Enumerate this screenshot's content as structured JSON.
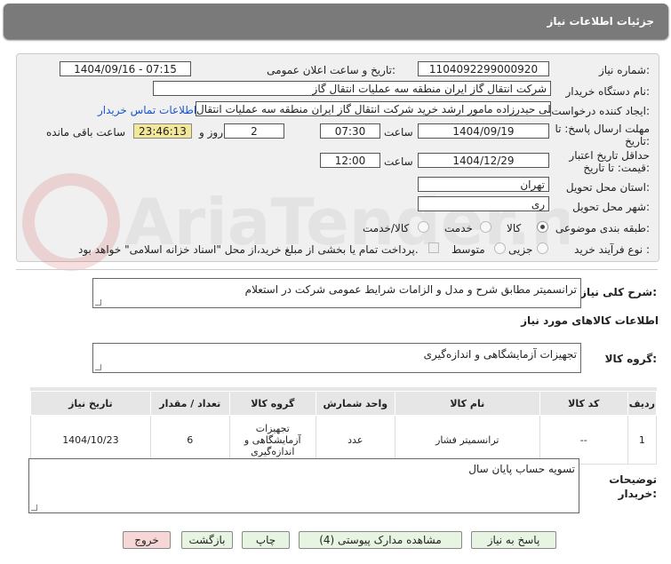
{
  "header": {
    "title": "جزئیات اطلاعات نیاز"
  },
  "form": {
    "need_number_label": "شماره نیاز:",
    "need_number": "1104092299000920",
    "announce_label": "تاریخ و ساعت اعلان عمومی:",
    "announce_value": "1404/09/16 - 07:15",
    "buyer_org_label": "نام دستگاه خریدار:",
    "buyer_org": "شرکت انتقال گاز ایران منطقه سه عملیات انتقال گاز",
    "creator_label": "ایجاد کننده درخواست:",
    "creator": "علی حیدرزاده مامور ارشد خرید شرکت انتقال گاز ایران منطقه سه عملیات انتقال",
    "contact_link": "اطلاعات تماس خریدار",
    "deadline_label_1": "مهلت ارسال پاسخ: تا",
    "deadline_label_2": "تاریخ:",
    "deadline_date": "1404/09/19",
    "time_label": "ساعت",
    "deadline_time": "07:30",
    "days_value": "2",
    "days_label": "روز و",
    "remaining_time": "23:46:13",
    "remaining_label": "ساعت باقی مانده",
    "validity_label_1": "حداقل تاریخ اعتبار",
    "validity_label_2": "قیمت: تا تاریخ:",
    "validity_date": "1404/12/29",
    "validity_time": "12:00",
    "province_label": "استان محل تحویل:",
    "province": "تهران",
    "city_label": "شهر محل تحویل:",
    "city": "ری",
    "category_label": "طبقه بندی موضوعی:",
    "category_options": [
      "کالا",
      "خدمت",
      "کالا/خدمت"
    ],
    "category_selected": "کالا",
    "process_label": "نوع فرآیند خرید :",
    "process_options": [
      "جزیی",
      "متوسط"
    ],
    "payment_note": "پرداخت تمام یا بخشی از مبلغ خرید،از محل \"اسناد خزانه اسلامی\" خواهد بود."
  },
  "summary": {
    "label": "شرح کلی نیاز:",
    "value": "ترانسمیتر مطابق شرح و مدل و الزامات شرایط عمومی شرکت در استعلام"
  },
  "goods": {
    "section_title": "اطلاعات کالاهای مورد نیاز",
    "group_label": "گروه کالا:",
    "group_value": "تجهیزات آزمایشگاهی و اندازه‌گیری"
  },
  "table": {
    "headers": [
      "ردیف",
      "کد کالا",
      "نام کالا",
      "واحد شمارش",
      "گروه کالا",
      "تعداد / مقدار",
      "تاریخ نیاز"
    ],
    "rows": [
      {
        "row": "1",
        "code": "--",
        "name": "ترانسمیتر فشار",
        "unit": "عدد",
        "group": "تجهیزات آزمایشگاهی و اندازه‌گیری",
        "qty": "6",
        "date": "1404/10/23"
      }
    ]
  },
  "buyer_notes": {
    "label_1": "توضیحات",
    "label_2": "خریدار:",
    "value": "تسویه حساب پایان سال"
  },
  "buttons": {
    "reply": "پاسخ به نیاز",
    "docs": "مشاهده مدارک پیوستی (4)",
    "print": "چاپ",
    "back": "بازگشت",
    "exit": "خروج"
  },
  "watermark": {
    "text": "AriaTender.neT"
  },
  "colors": {
    "header_bg": "#7a7a7a",
    "timer_bg": "#f3e79a",
    "link": "#1a55d0",
    "exit_btn": "#f6d6d6",
    "action_btn": "#e8f4e2"
  }
}
